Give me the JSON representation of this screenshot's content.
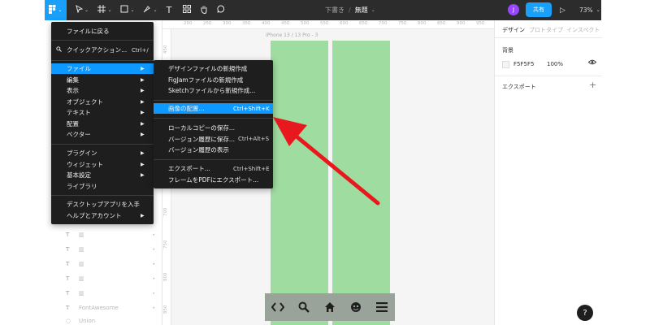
{
  "toolbar": {
    "main_menu_icon": "figma-logo-icon",
    "tools": [
      "move-tool-icon",
      "frame-tool-icon",
      "shape-tool-icon",
      "pen-tool-icon",
      "text-tool-icon",
      "resources-icon",
      "hand-tool-icon",
      "comment-tool-icon"
    ],
    "text_tool_glyph": "T",
    "breadcrumb_draft": "下書き",
    "breadcrumb_sep": "/",
    "file_name": "無題",
    "avatar_initial": "J",
    "share_label": "共有",
    "zoom_level": "73%"
  },
  "main_menu": {
    "items": [
      {
        "label": "ファイルに戻る"
      },
      {
        "label": "クイックアクション...",
        "shortcut": "Ctrl+/"
      },
      {
        "label": "ファイル",
        "submenu": true,
        "highlighted": true
      },
      {
        "label": "編集",
        "submenu": true
      },
      {
        "label": "表示",
        "submenu": true
      },
      {
        "label": "オブジェクト",
        "submenu": true
      },
      {
        "label": "テキスト",
        "submenu": true
      },
      {
        "label": "配置",
        "submenu": true
      },
      {
        "label": "ベクター",
        "submenu": true
      },
      {
        "label": "プラグイン",
        "submenu": true
      },
      {
        "label": "ウィジェット",
        "submenu": true
      },
      {
        "label": "基本設定",
        "submenu": true
      },
      {
        "label": "ライブラリ"
      },
      {
        "label": "デスクトップアプリを入手"
      },
      {
        "label": "ヘルプとアカウント",
        "submenu": true
      }
    ]
  },
  "file_submenu": {
    "items": [
      {
        "label": "デザインファイルの新規作成"
      },
      {
        "label": "FigJamファイルの新規作成"
      },
      {
        "label": "Sketchファイルから新規作成..."
      },
      {
        "label": "画像の配置...",
        "shortcut": "Ctrl+Shift+K",
        "highlighted": true
      },
      {
        "label": "ローカルコピーの保存..."
      },
      {
        "label": "バージョン履歴に保存...",
        "shortcut": "Ctrl+Alt+S"
      },
      {
        "label": "バージョン履歴の表示"
      },
      {
        "label": "エクスポート...",
        "shortcut": "Ctrl+Shift+E"
      },
      {
        "label": "フレームをPDFにエクスポート..."
      }
    ]
  },
  "layers": [
    {
      "icon": "text-layer-icon",
      "name": ""
    },
    {
      "icon": "text-layer-icon",
      "name": ""
    },
    {
      "icon": "text-layer-icon",
      "name": ""
    },
    {
      "icon": "text-layer-icon",
      "name": ""
    },
    {
      "icon": "text-layer-icon",
      "name": ""
    },
    {
      "icon": "text-layer-icon",
      "name": ""
    },
    {
      "icon": "text-layer-icon",
      "name": "FontAwesome"
    },
    {
      "icon": "union-icon",
      "name": "Union"
    }
  ],
  "canvas": {
    "ruler_top": [
      "200",
      "250",
      "300",
      "350",
      "400",
      "450",
      "500",
      "550",
      "600",
      "650",
      "700",
      "750",
      "800",
      "850",
      "900",
      "950",
      "100"
    ],
    "ruler_left": [
      "450",
      "500",
      "550",
      "600",
      "650",
      "700",
      "750",
      "800",
      "850"
    ],
    "frame_label": "iPhone 13 / 13 Pro - 3",
    "bg_color": "#F5F5F5",
    "column_color": "#9FDCA0",
    "nav_icons": [
      "code-icon",
      "search-icon",
      "home-icon",
      "theater-masks-icon",
      "menu-bars-icon"
    ],
    "nav_glyphs": [
      "‹›",
      "⚲",
      "⌂",
      "◕",
      "≡"
    ]
  },
  "right_panel": {
    "tabs": [
      "デザイン",
      "プロトタイプ",
      "インスペクト"
    ],
    "background_title": "背景",
    "background_hex": "F5F5F5",
    "background_opacity": "100%",
    "export_title": "エクスポート"
  },
  "help_label": "?",
  "colors": {
    "accent": "#18A0FB",
    "toolbar": "#2C2C2C",
    "menu_bg": "#1E1E1E",
    "arrow": "#E8191E"
  }
}
